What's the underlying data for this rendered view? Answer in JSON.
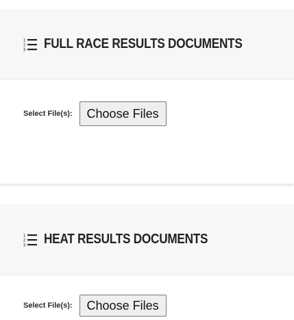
{
  "sections": [
    {
      "title": "FULL RACE RESULTS DOCUMENTS",
      "icon": "list-ol-icon",
      "file_label": "Select File(s):",
      "button_label": "Choose Files"
    },
    {
      "title": "HEAT RESULTS DOCUMENTS",
      "icon": "list-ol-icon",
      "file_label": "Select File(s):",
      "button_label": "Choose Files"
    }
  ],
  "icon_glyphs": [
    "1",
    "2",
    "3"
  ],
  "colors": {
    "header_background": "#f7f7f7",
    "title_text": "#222222",
    "button_background": "#efefef",
    "button_border": "#767676"
  }
}
